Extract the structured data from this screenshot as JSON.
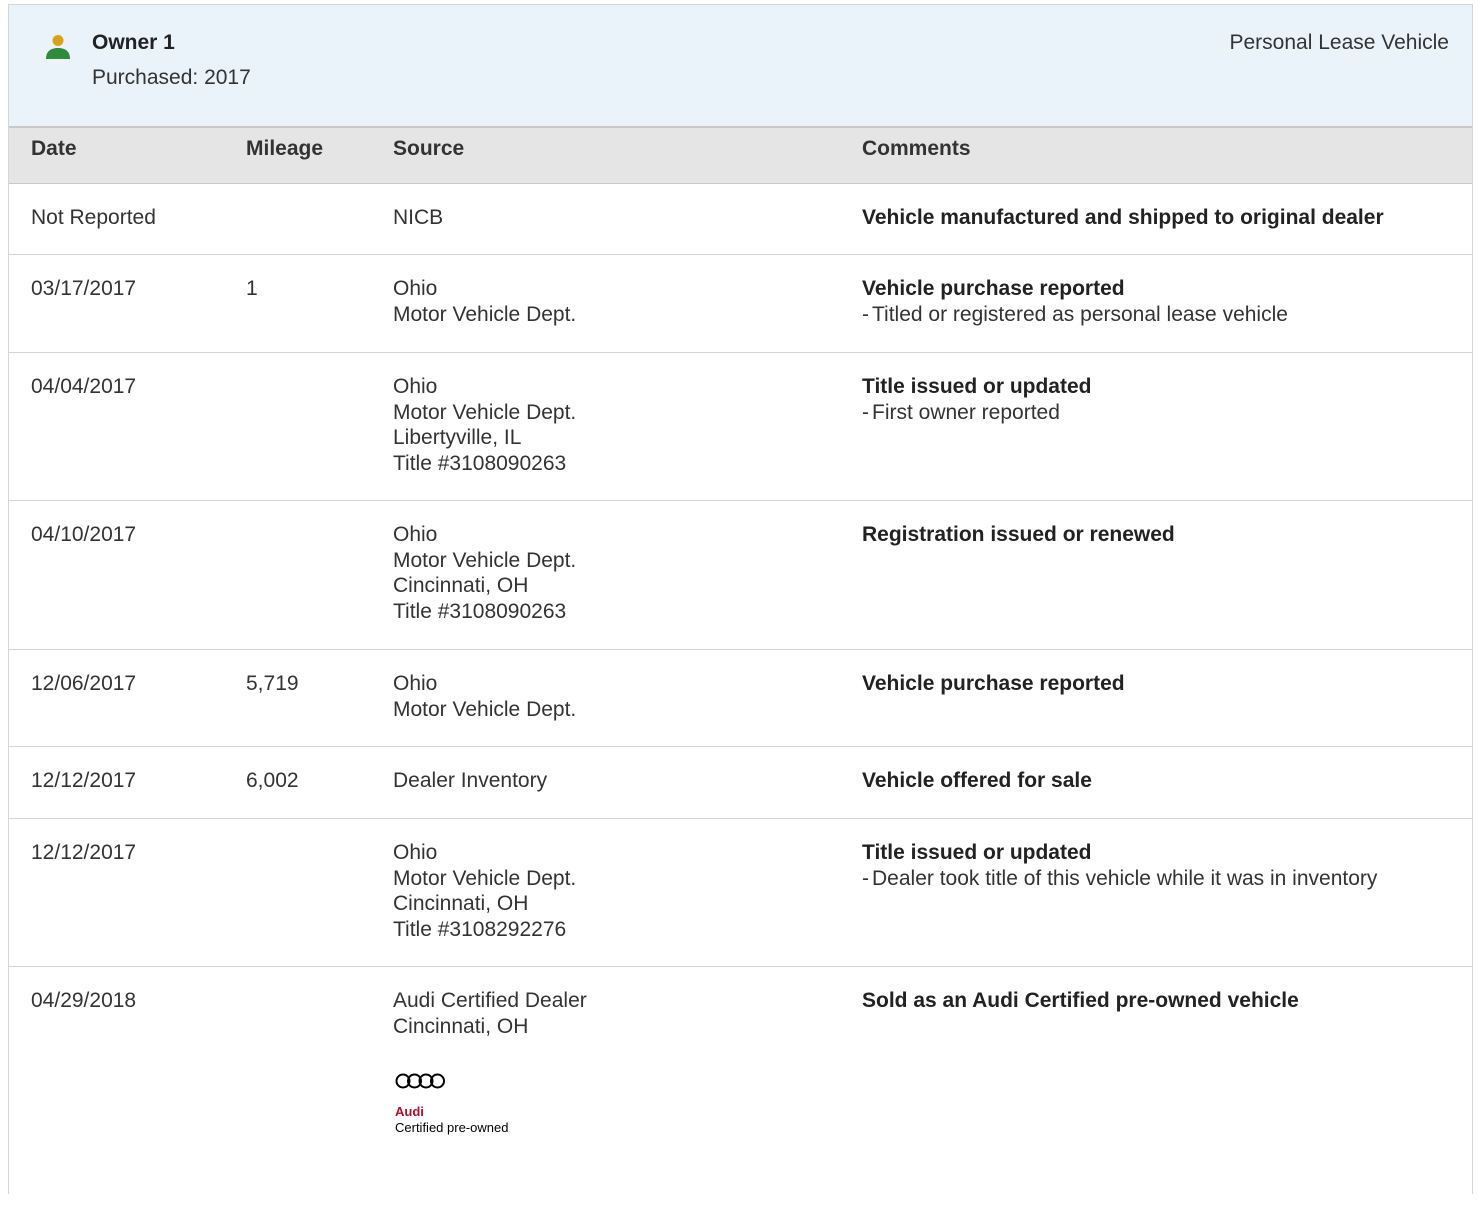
{
  "owner": {
    "title": "Owner 1",
    "purchased": "Purchased: 2017",
    "vehicle_type": "Personal Lease Vehicle",
    "icon": "person-icon",
    "icon_colors": {
      "head": "#d9a21b",
      "body": "#2e8b3a"
    }
  },
  "table": {
    "headers": {
      "date": "Date",
      "mileage": "Mileage",
      "source": "Source",
      "comments": "Comments"
    },
    "rows": [
      {
        "date": "Not Reported",
        "mileage": "",
        "source": [
          "NICB"
        ],
        "comment_title": "Vehicle manufactured and shipped to original dealer",
        "comment_detail": ""
      },
      {
        "date": "03/17/2017",
        "mileage": "1",
        "source": [
          "Ohio",
          "Motor Vehicle Dept."
        ],
        "comment_title": "Vehicle purchase reported",
        "comment_detail": "Titled or registered as personal lease vehicle"
      },
      {
        "date": "04/04/2017",
        "mileage": "",
        "source": [
          "Ohio",
          "Motor Vehicle Dept.",
          "Libertyville, IL",
          "Title #3108090263"
        ],
        "comment_title": "Title issued or updated",
        "comment_detail": "First owner reported"
      },
      {
        "date": "04/10/2017",
        "mileage": "",
        "source": [
          "Ohio",
          "Motor Vehicle Dept.",
          "Cincinnati, OH",
          "Title #3108090263"
        ],
        "comment_title": "Registration issued or renewed",
        "comment_detail": ""
      },
      {
        "date": "12/06/2017",
        "mileage": "5,719",
        "source": [
          "Ohio",
          "Motor Vehicle Dept."
        ],
        "comment_title": "Vehicle purchase reported",
        "comment_detail": ""
      },
      {
        "date": "12/12/2017",
        "mileage": "6,002",
        "source": [
          "Dealer Inventory"
        ],
        "comment_title": "Vehicle offered for sale",
        "comment_detail": ""
      },
      {
        "date": "12/12/2017",
        "mileage": "",
        "source": [
          "Ohio",
          "Motor Vehicle Dept.",
          "Cincinnati, OH",
          "Title #3108292276"
        ],
        "comment_title": "Title issued or updated",
        "comment_detail": "Dealer took title of this vehicle while it was in inventory"
      },
      {
        "date": "04/29/2018",
        "mileage": "",
        "source": [
          "Audi Certified Dealer",
          "Cincinnati, OH"
        ],
        "comment_title": "Sold as an Audi Certified pre-owned vehicle",
        "comment_detail": ""
      }
    ]
  },
  "badge": {
    "icon": "audi-rings-icon",
    "brand": "Audi",
    "label": "Certified pre-owned",
    "brand_color": "#bb0a30"
  }
}
